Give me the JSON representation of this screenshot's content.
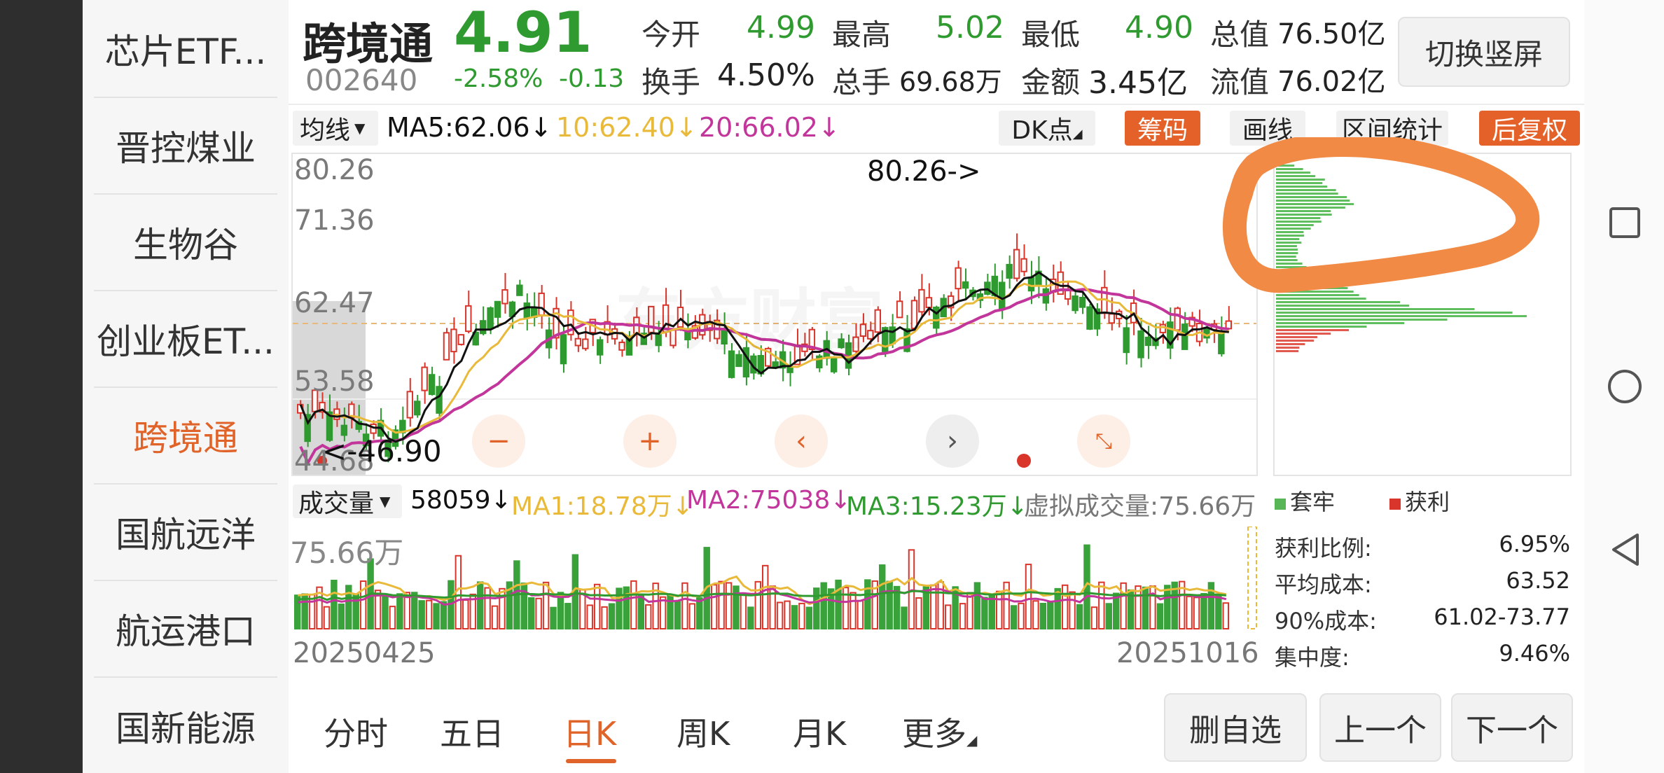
{
  "sidebar": {
    "items": [
      {
        "label": "芯片ETF..."
      },
      {
        "label": "晋控煤业"
      },
      {
        "label": "生物谷"
      },
      {
        "label": "创业板ET..."
      },
      {
        "label": "跨境通"
      },
      {
        "label": "国航远洋"
      },
      {
        "label": "航运港口"
      },
      {
        "label": "国新能源"
      }
    ],
    "active_index": 4
  },
  "stock": {
    "name": "跨境通",
    "code": "002640",
    "price": "4.91",
    "change_pct": "-2.58%",
    "change": "-0.13",
    "open_label": "今开",
    "open": "4.99",
    "high_label": "最高",
    "high": "5.02",
    "low_label": "最低",
    "low": "4.90",
    "total_value_label": "总值",
    "total_value": "76.50亿",
    "turnover_label": "换手",
    "turnover": "4.50%",
    "total_hands_label": "总手",
    "total_hands": "69.68万",
    "amount_label": "金额",
    "amount": "3.45亿",
    "float_value_label": "流值",
    "float_value": "76.02亿"
  },
  "toggle_button": "切换竖屏",
  "toolbar": {
    "ma_select": "均线",
    "ma5": "MA5:62.06",
    "ma10": "10:62.40",
    "ma20": "20:66.02",
    "dk_label": "DK点",
    "chips_label": "筹码",
    "draw_label": "画线",
    "range_stats_label": "区间统计",
    "adjust_label": "后复权"
  },
  "colors": {
    "accent": "#e0642a",
    "up": "#d9352b",
    "down": "#2f9a2f",
    "ma5": "#111111",
    "ma10": "#e9b93a",
    "ma20": "#c2359a"
  },
  "kline": {
    "y_ticks": [
      "80.26",
      "71.36",
      "62.47",
      "53.58",
      "44.68"
    ],
    "high_marker": "80.26->",
    "low_marker": "<-46.90",
    "watermark": "东方财富"
  },
  "chips": {
    "legend_trapped": "套牢",
    "legend_profit": "获利",
    "stats": [
      {
        "label": "获利比例:",
        "value": "6.95%"
      },
      {
        "label": "平均成本:",
        "value": "63.52"
      },
      {
        "label": "90%成本:",
        "value": "61.02-73.77"
      },
      {
        "label": "集中度:",
        "value": "9.46%"
      }
    ]
  },
  "volume": {
    "select": "成交量",
    "current": "58059",
    "ma1": "MA1:18.78万",
    "ma2": "MA2:75038",
    "ma3": "MA3:15.23万",
    "virtual": "虚拟成交量:75.66万",
    "max_label": "75.66万",
    "start_date": "20250425",
    "end_date": "20251016"
  },
  "tabs": [
    {
      "label": "分时"
    },
    {
      "label": "五日"
    },
    {
      "label": "日K"
    },
    {
      "label": "周K"
    },
    {
      "label": "月K"
    },
    {
      "label": "更多"
    }
  ],
  "active_tab": 2,
  "bottom_buttons": {
    "remove_watch": "删自选",
    "prev": "上一个",
    "next": "下一个"
  }
}
